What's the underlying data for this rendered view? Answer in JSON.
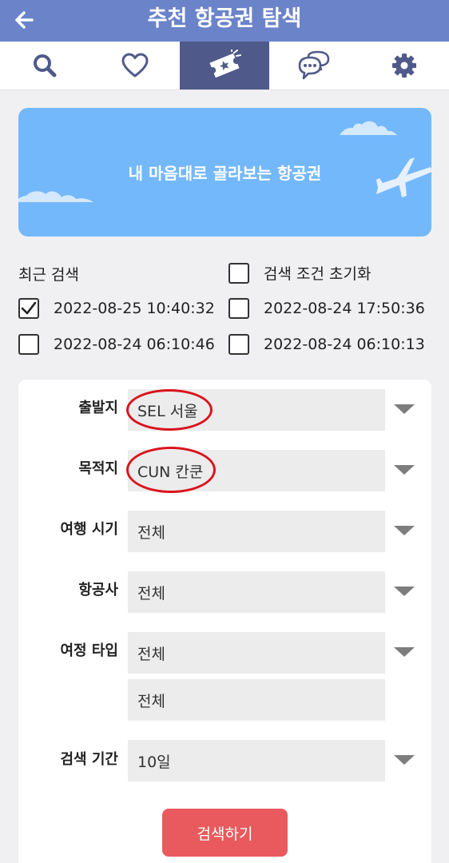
{
  "header": {
    "title": "추천 항공권 탐색"
  },
  "tabs": [
    {
      "icon": "search-icon",
      "active": false
    },
    {
      "icon": "heart-icon",
      "active": false
    },
    {
      "icon": "ticket-icon",
      "active": true
    },
    {
      "icon": "chat-icon",
      "active": false
    },
    {
      "icon": "gear-icon",
      "active": false
    }
  ],
  "banner": {
    "text": "내 마음대로 골라보는 항공권"
  },
  "recent": {
    "label": "최근 검색",
    "reset_label": "검색 조건 초기화",
    "items": [
      {
        "text": "2022-08-25 10:40:32",
        "checked": true
      },
      {
        "text": "2022-08-24 17:50:36",
        "checked": false
      },
      {
        "text": "2022-08-24 06:10:46",
        "checked": false
      },
      {
        "text": "2022-08-24 06:10:13",
        "checked": false
      }
    ]
  },
  "form": {
    "departure": {
      "label": "출발지",
      "value": "SEL 서울"
    },
    "destination": {
      "label": "목적지",
      "value": "CUN 칸쿤"
    },
    "travel_time": {
      "label": "여행 시기",
      "value": "전체"
    },
    "airline": {
      "label": "항공사",
      "value": "전체"
    },
    "trip_type": {
      "label": "여정 타입",
      "value": "전체",
      "value2": "전체"
    },
    "search_period": {
      "label": "검색 기간",
      "value": "10일"
    },
    "submit_label": "검색하기"
  },
  "colors": {
    "header": "#6b83c9",
    "active_tab": "#4f5a8a",
    "banner": "#74b8fc",
    "button": "#e85a5d",
    "annotation": "#d9141e"
  }
}
